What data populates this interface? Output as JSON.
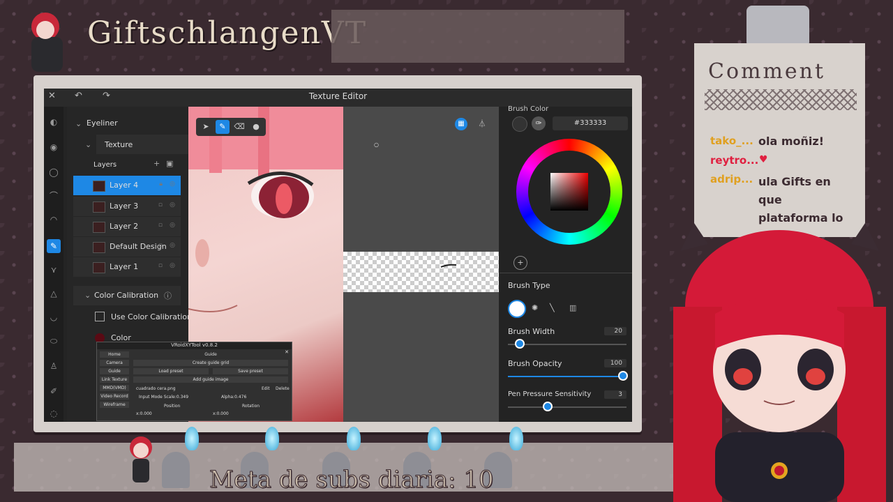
{
  "overlay": {
    "channel_title": "GiftschlangenVT",
    "sub_goal": "Meta de subs diaria: 10"
  },
  "window": {
    "title": "Texture Editor"
  },
  "left_panel": {
    "eyeliner_label": "Eyeliner",
    "texture_label": "Texture",
    "layers_label": "Layers",
    "layers": [
      {
        "name": "Layer 4",
        "selected": true
      },
      {
        "name": "Layer 3",
        "selected": false
      },
      {
        "name": "Layer 2",
        "selected": false
      },
      {
        "name": "Default Design",
        "selected": false
      },
      {
        "name": "Layer 1",
        "selected": false
      }
    ],
    "color_calibration_label": "Color Calibration",
    "use_color_calibration_label": "Use Color Calibration",
    "color_label": "Color"
  },
  "right_panel": {
    "brush_color_label": "Brush Color",
    "hex_value": "#333333",
    "brush_type_label": "Brush Type",
    "brush_width_label": "Brush Width",
    "brush_width_value": "20",
    "brush_opacity_label": "Brush Opacity",
    "brush_opacity_value": "100",
    "pen_pressure_label": "Pen Pressure Sensitivity",
    "pen_pressure_value": "3"
  },
  "vroid_tool": {
    "title": "VRoidXYTool v0.8.2",
    "nav": [
      "Home",
      "Camera",
      "Guide",
      "Link Texture",
      "MMD(VMD)",
      "Video Record",
      "Wireframe"
    ],
    "guide_label": "Guide",
    "create_guide_grid": "Create guide grid",
    "load_preset": "Load preset",
    "save_preset": "Save preset",
    "add_guide_image": "Add guide image",
    "file_name": "cuadrado cera.png",
    "edit_label": "Edit",
    "delete_label": "Delete",
    "input_mode_scale": "Input Mode Scale:0.349",
    "alpha": "Alpha:0.476",
    "position_label": "Position",
    "rotation_label": "Rotation",
    "pos_x": "x:0.000",
    "rot_x": "x:0.000"
  },
  "comments": {
    "header": "Comment",
    "items": [
      {
        "user": "tako_...",
        "color": "#e0a020",
        "message": "ola moñiz!"
      },
      {
        "user": "reytro...",
        "color": "#e02040",
        "message": ""
      },
      {
        "user": "adrip...",
        "color": "#e0a020",
        "message": "ula Gifts en que plataforma lo estas haciendo"
      }
    ]
  },
  "colors": {
    "accent": "#1e88e5",
    "panel": "#262626"
  }
}
